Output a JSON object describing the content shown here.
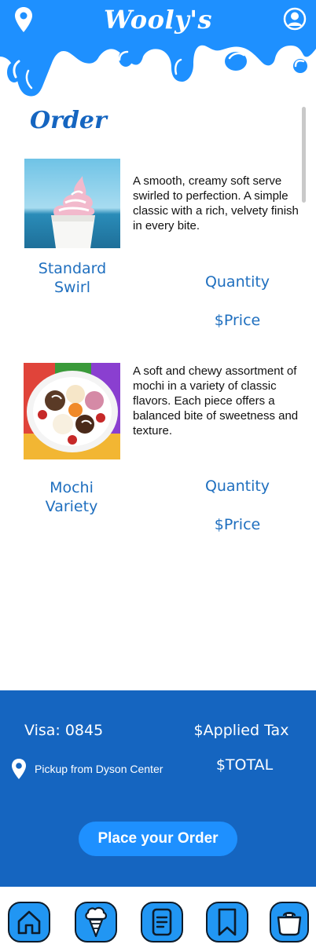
{
  "header": {
    "brand": "Wooly's",
    "icons": [
      "location-pin-icon",
      "profile-icon"
    ]
  },
  "order": {
    "title": "Order",
    "items": [
      {
        "name": "Standard Swirl",
        "description": "A smooth, creamy soft serve swirled to perfection. A simple classic with a rich, velvety finish in every bite.",
        "quantity_label": "Quantity",
        "price_label": "$Price"
      },
      {
        "name": "Mochi Variety",
        "description": "A soft and chewy assortment of mochi in a variety of classic flavors. Each piece offers a balanced bite of sweetness and texture.",
        "quantity_label": "Quantity",
        "price_label": "$Price"
      }
    ]
  },
  "summary": {
    "payment": "Visa: 0845",
    "tax_label": "$Applied Tax",
    "pickup": "Pickup from Dyson Center",
    "total_label": "$TOTAL",
    "place_order": "Place your Order"
  },
  "tabbar": {
    "tabs": [
      "home-icon",
      "ice-cream-icon",
      "menu-list-icon",
      "bookmark-icon",
      "cart-icon"
    ]
  },
  "colors": {
    "brand_blue": "#1565c0",
    "drip_blue": "#1e90ff",
    "link_blue": "#1f6fbf",
    "tab_blue": "#2196f3"
  }
}
